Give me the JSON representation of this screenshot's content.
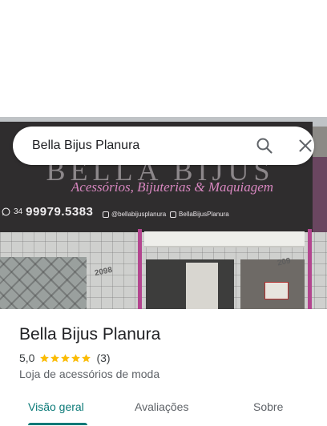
{
  "search": {
    "query": "Bella Bijus Planura"
  },
  "photo": {
    "sign_title": "BELLA BIJUS",
    "sign_subtitle": "Acessórios, Bijuterias & Maquiagem",
    "phone_ddd": "34",
    "phone_number": "99979.5383",
    "instagram_handle": "@bellabijusplanura",
    "facebook_handle": "BellaBijusPlanura",
    "street_number_left": "2098",
    "street_number_right": "209"
  },
  "place": {
    "title": "Bella Bijus Planura",
    "rating": "5,0",
    "stars": 5,
    "review_count": "(3)",
    "category": "Loja de acessórios de moda"
  },
  "tabs": [
    {
      "label": "Visão geral",
      "active": true
    },
    {
      "label": "Avaliações",
      "active": false
    },
    {
      "label": "Sobre",
      "active": false
    }
  ],
  "colors": {
    "accent": "#0b7a78",
    "star": "#fbbc04",
    "sign_pink": "#d887c0"
  }
}
